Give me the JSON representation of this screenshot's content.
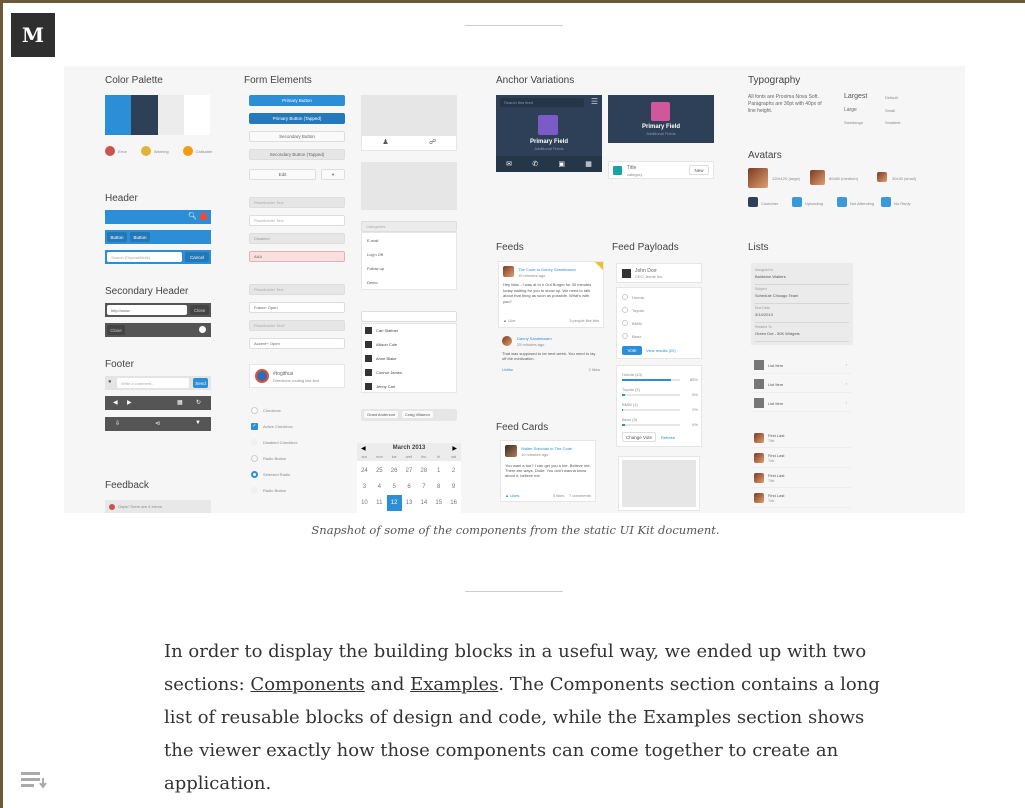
{
  "logo": {
    "letter": "M"
  },
  "caption": "Snapshot of some of the components from the static UI Kit document.",
  "article": {
    "p1": "In order to display the building blocks in a useful way, we ended up with two sections: ",
    "link1": "Components",
    "and": " and ",
    "link2": "Examples",
    "p2": ". The Components section contains a long list of reusable blocks of design and code, while the Examples section shows the viewer exactly how those components can come together to create an application."
  },
  "kit": {
    "color_palette": {
      "title": "Color Palette",
      "swatches": [
        "#2b8ed6",
        "#2e4057",
        "#ececec",
        "#ffffff"
      ],
      "status": [
        {
          "label": "Error",
          "color": "#c9534f"
        },
        {
          "label": "Warning",
          "color": "#e2b23a"
        },
        {
          "label": "Callsaiter",
          "color": "#f39c12"
        }
      ]
    },
    "header": {
      "title": "Header",
      "btn1": "Button",
      "btn2": "Button",
      "search_placeholder": "Search (Repeat/Multi)",
      "cancel": "Cancel"
    },
    "secondary_header": {
      "title": "Secondary Header",
      "url": "http://www",
      "close": "Close",
      "btn": "Close"
    },
    "footer": {
      "title": "Footer",
      "comment_placeholder": "Write a comment...",
      "send": "Send"
    },
    "feedback": {
      "title": "Feedback",
      "message": "Oops! There are 4 errors"
    },
    "form": {
      "title": "Form Elements",
      "primary": "Primary Button",
      "primary_tapped": "Primary Button (Tapped)",
      "secondary": "Secondary Button",
      "secondary_tapped": "Secondary Button (Tapped)",
      "edit": "Edit",
      "ph1": "Placeholder Text",
      "ph2": "Placeholder Text",
      "disabled": "Disabled",
      "error_val": "AAA",
      "ph3": "Placeholder Text",
      "select1": "Frame: Open",
      "ph4": "Placeholder Text*",
      "select2": "Accent*: Open",
      "user_name": "#togithus",
      "user_sub": "Directions routing line text",
      "checkbox": "Checkbox",
      "active_checkbox": "Active Checkbox",
      "disabled_checkbox": "Disabled Checkbox",
      "radio": "Radio Button",
      "selected_radio": "Selected Radio",
      "radio2": "Radio Button"
    },
    "dropdown": {
      "placeholder": "Categories",
      "items": [
        "E-mail",
        "Log'n Off",
        "Follow up",
        "Demo"
      ]
    },
    "people": [
      "Carl Slattner",
      "Allison Cole",
      "Anne Blake",
      "Connor James",
      "Jenny Carl"
    ],
    "tags": [
      "Grant Anderson",
      "Craig Villamor"
    ],
    "calendar": {
      "month": "March 2013",
      "days": [
        "sun",
        "mon",
        "tue",
        "wed",
        "thu",
        "fri",
        "sat"
      ],
      "weeks": [
        [
          "24",
          "25",
          "26",
          "27",
          "28",
          "1",
          "2"
        ],
        [
          "3",
          "4",
          "5",
          "6",
          "7",
          "8",
          "9"
        ],
        [
          "10",
          "11",
          "12",
          "13",
          "14",
          "15",
          "16"
        ]
      ],
      "selected": "12"
    },
    "anchor": {
      "title": "Anchor Variations",
      "search_placeholder": "Search this feed",
      "primary_field": "Primary Field",
      "additional": "Additional Fields",
      "item_title": "Title",
      "item_sub": "category",
      "new_btn": "New"
    },
    "feeds": {
      "title": "Feeds",
      "author": "The Code",
      "to": "Doney Sandekwam",
      "time": "15 minutes ago",
      "body": "Hey Man - I was at In n Out Burger for 30 minutes today waiting for you to show up. We need to talk about that thing as soon as possible. What's with you?",
      "like": "Like",
      "meta": "3 people like this",
      "reply_author": "Danny Sandekwam",
      "reply_time": "25 minutes ago",
      "reply_body": "That was supposed to be next week. You need to lay off the medication.",
      "unlike": "Unlike",
      "likes": "2 likes"
    },
    "feed_cards": {
      "title": "Feed Cards",
      "author": "Walter Sobchak to The Code",
      "time": "10 minutes ago",
      "body": "You want a toe? I can get you a toe. Believe me. There are ways, Dude. You don't wanna know about it, believe me.",
      "like": "Likes",
      "likes": "5 likes",
      "comments": "7 comments"
    },
    "payloads": {
      "title": "Feed Payloads",
      "name": "John Dorr",
      "sub": "CEO, Acme Inc",
      "options": [
        "Honda",
        "Toyota",
        "BMW",
        "Benz"
      ],
      "vote": "Vote",
      "view": "View results (20)",
      "results": [
        {
          "label": "Honda (43)",
          "pct": "85%",
          "value": 85
        },
        {
          "label": "Toyota (3)",
          "pct": "6%",
          "value": 6
        },
        {
          "label": "BMW (1)",
          "pct": "2%",
          "value": 2
        },
        {
          "label": "Benz (3)",
          "pct": "6%",
          "value": 6
        }
      ],
      "change": "Change Vote",
      "refresh": "Refresh"
    },
    "typography": {
      "title": "Typography",
      "desc": "All fonts are Proxima Nova Soft. Paragraphs are 30pt with 40px of line height.",
      "sizes": [
        [
          "Largest",
          "Default"
        ],
        [
          "Large",
          "Small"
        ],
        [
          "Sanidango",
          "Smallest"
        ]
      ]
    },
    "avatars": {
      "title": "Avatars",
      "sizes": [
        "120x120 (large)",
        "80x80 (medium)",
        "30x30 (small)"
      ],
      "states": [
        "Customer",
        "Uploading",
        "Not Attending",
        "No Reply"
      ]
    },
    "lists": {
      "title": "Lists",
      "fields": [
        {
          "k": "Assigned to",
          "v": "Baldwine Walters"
        },
        {
          "k": "Subject",
          "v": "Schedule Chicago Team"
        },
        {
          "k": "Due Date",
          "v": "3/14/2013"
        },
        {
          "k": "Related To",
          "v": "Green Dot - 50K Widgets"
        }
      ],
      "items": [
        "List Item",
        "List Item",
        "List Item"
      ],
      "people": [
        {
          "n": "First Last",
          "s": "Title"
        },
        {
          "n": "First Last",
          "s": "Title"
        },
        {
          "n": "First Last",
          "s": "Title"
        },
        {
          "n": "First Last",
          "s": "Title"
        }
      ]
    }
  }
}
